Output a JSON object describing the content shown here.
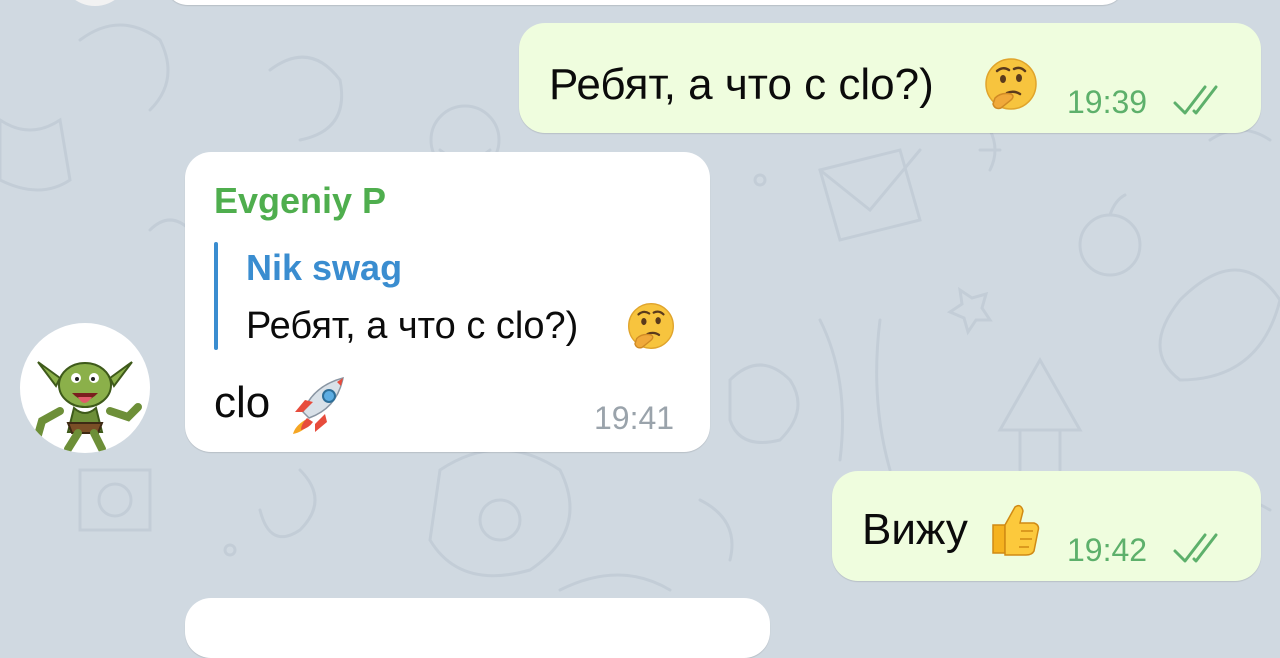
{
  "theme": {
    "background": "#d0d9e1",
    "outgoing_bubble": "#effdde",
    "incoming_bubble": "#ffffff",
    "sender_name_color": "#4fae4e",
    "reply_accent": "#3a8dd0",
    "outgoing_meta_color": "#5db06b",
    "incoming_meta_color": "#9aa3ab"
  },
  "messages": [
    {
      "direction": "outgoing",
      "text": "Ребят, а что с clo?)",
      "emoji": "thinking-face",
      "time": "19:39",
      "status": "read"
    },
    {
      "direction": "incoming",
      "sender": "Evgeniy P",
      "reply_to": {
        "sender": "Nik swag",
        "text": "Ребят, а что с clo?)",
        "emoji": "thinking-face"
      },
      "text": "clo",
      "emoji": "rocket",
      "time": "19:41",
      "avatar": "goblin-avatar"
    },
    {
      "direction": "outgoing",
      "text": "Вижу",
      "emoji": "thumbs-up",
      "time": "19:42",
      "status": "read"
    }
  ]
}
